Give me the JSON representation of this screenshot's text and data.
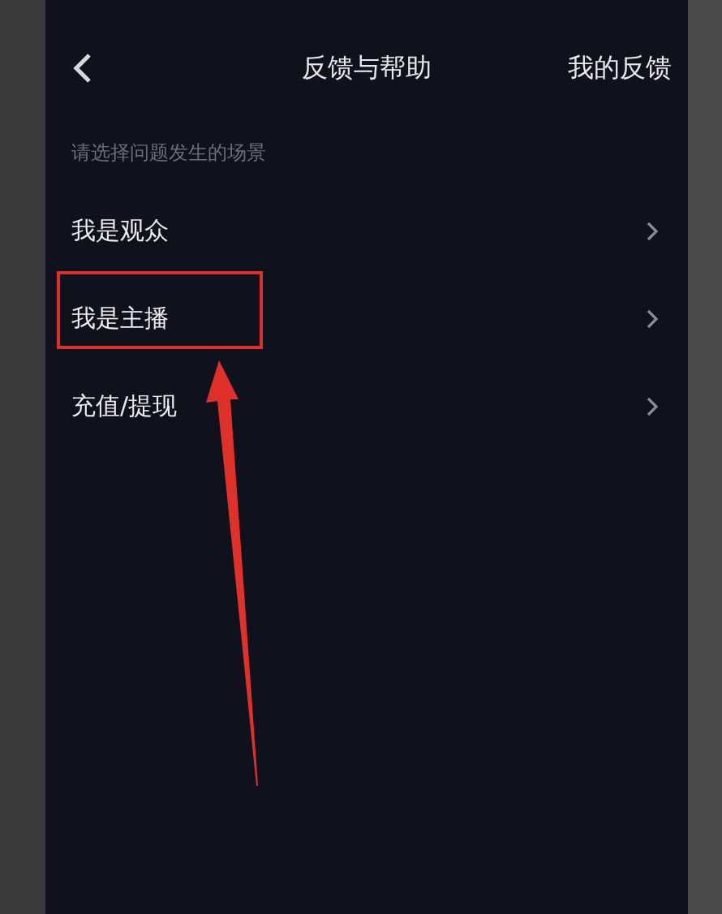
{
  "nav": {
    "title": "反馈与帮助",
    "action": "我的反馈"
  },
  "hint": "请选择问题发生的场景",
  "options": [
    {
      "label": "我是观众",
      "annotated": false
    },
    {
      "label": "我是主播",
      "annotated": true
    },
    {
      "label": "充值/提现",
      "annotated": false
    }
  ]
}
